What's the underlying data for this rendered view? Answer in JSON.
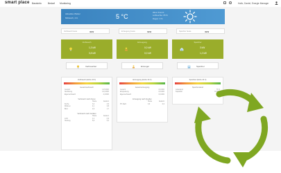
{
  "colors": {
    "accent_green": "#9aad2b",
    "weather_blue": "#3a83bf",
    "cycle_green": "#7fa722"
  },
  "header": {
    "logo": "smart place",
    "nav": [
      "Basisinfo",
      "Bedarf",
      "Monitoring"
    ],
    "user": "Hallo, Daniel, Energie Manager"
  },
  "weather": {
    "line1": "Aktuelles Wetter",
    "line2": "Mittwoch, 4.9.",
    "temp": "5 °C",
    "info1": "Wind: 8 km/h",
    "info2": "Luftfeuchte: 65 %",
    "info3": "Regen: 0 %",
    "icon": "sun-icon"
  },
  "strips": [
    {
      "label": "Verbrauch heute",
      "value": "3kW"
    },
    {
      "label": "Erzeugung heute",
      "value": "0kW"
    },
    {
      "label": "Speicher heute",
      "value": "3kW"
    }
  ],
  "columns": [
    {
      "title": "Verbrauch",
      "icon": "bulb-icon",
      "val1": "1,3 kW",
      "val2": "0,8 kW",
      "button": "Verbraucher",
      "panel_title": "Verbrauch (letzte 24 h)"
    },
    {
      "title": "Erzeugung",
      "icon": "solar-icon",
      "val1": "0,0 kW",
      "val2": "0,0 kW",
      "button": "Erzeuger",
      "panel_title": "Erzeugung (letzte 24 h)"
    },
    {
      "title": "Speicher",
      "icon": "house-battery-icon",
      "val1": "3 kW",
      "val2": "1,2 kW",
      "button": "Speicher",
      "panel_title": "Speicher (letzte 24 h)"
    }
  ],
  "panels": {
    "p1": {
      "section1": "Gesamtverbrauch",
      "rows1": [
        [
          "Gesamt",
          "",
          "14,5 kWh"
        ],
        [
          "Netzbezug",
          "",
          "10,2 kWh"
        ],
        [
          "Eigenverbrauch",
          "",
          "4,3 kWh"
        ]
      ],
      "section2": "Verbrauch nach Zonen",
      "rows2": [
        [
          "",
          "Heute",
          "Gestern"
        ],
        [
          "Küche",
          "3,2",
          "2,9"
        ],
        [
          "Wohnen",
          "4,1",
          "3,8"
        ],
        [
          "Büro",
          "2,0",
          "1,7"
        ]
      ],
      "section3": "Verbrauch nach Geräten",
      "rows3": [
        [
          "",
          "Heute",
          "Gestern"
        ],
        [
          "Licht",
          "1,1",
          "0,9"
        ],
        [
          "Heizung",
          "5,6",
          "5,2"
        ]
      ]
    },
    "p2": {
      "section1": "Gesamterzeugung",
      "rows1": [
        [
          "Gesamt",
          "",
          "0,0 kWh"
        ],
        [
          "Einspeisung",
          "",
          "0,0 kWh"
        ],
        [
          "Eigenverbrauch",
          "",
          "0,0 kWh"
        ]
      ],
      "section2": "Erzeugung nach Quellen",
      "rows2": [
        [
          "",
          "Heute",
          "Gestern"
        ],
        [
          "PV Dach",
          "0,0",
          "0,0"
        ]
      ]
    },
    "p3": {
      "section1": "Speicherstand",
      "rows1": [
        [
          "Ladestand",
          "",
          "73 %"
        ],
        [
          "Kapazität",
          "",
          "10 kWh"
        ]
      ]
    }
  },
  "overlay": {
    "icon": "cycle-arrows-icon"
  }
}
